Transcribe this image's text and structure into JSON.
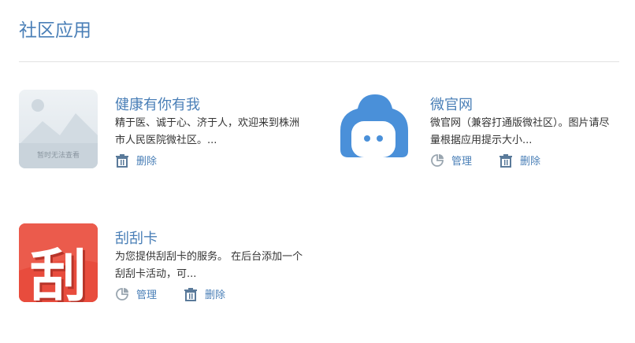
{
  "page": {
    "title": "社区应用"
  },
  "apps": [
    {
      "name": "健康有你有我",
      "description": "精于医、诚于心、济于人，欢迎来到株洲市人民医院微社区。...",
      "thumbnail_text": "暂时无法查看",
      "icon": "image-placeholder",
      "actions": [
        {
          "label": "删除",
          "icon": "trash-icon"
        }
      ]
    },
    {
      "name": "微官网",
      "description": "微官网（兼容打通版微社区）。图片请尽量根据应用提示大小...",
      "icon": "house-face-icon",
      "actions": [
        {
          "label": "管理",
          "icon": "pie-chart-icon"
        },
        {
          "label": "删除",
          "icon": "trash-icon"
        }
      ]
    },
    {
      "name": "刮刮卡",
      "description": "为您提供刮刮卡的服务。 在后台添加一个刮刮卡活动，可...",
      "thumbnail_text": "刮",
      "icon": "scratch-card-icon",
      "actions": [
        {
          "label": "管理",
          "icon": "pie-chart-icon"
        },
        {
          "label": "删除",
          "icon": "trash-icon"
        }
      ]
    }
  ],
  "colors": {
    "accent": "#4a7fb7",
    "scratch_red": "#e84c3d",
    "wechat_blue": "#4a90d9"
  }
}
